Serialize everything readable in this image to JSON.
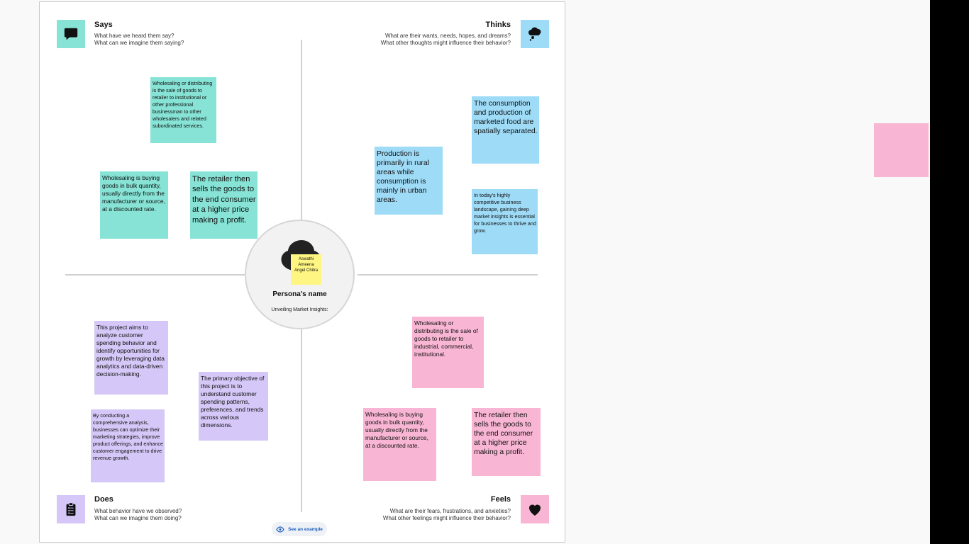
{
  "colors": {
    "teal": "#86e3d5",
    "blue": "#9edbf7",
    "purple": "#d5c7f7",
    "pink": "#f9b6d4",
    "yellow": "#fff583",
    "link": "#1d5fbf"
  },
  "quadrants": {
    "says": {
      "title": "Says",
      "line1": "What have we heard them say?",
      "line2": "What can we imagine them saying?",
      "icon": "speech-bubble-icon"
    },
    "thinks": {
      "title": "Thinks",
      "line1": "What are their wants, needs, hopes, and dreams?",
      "line2": "What other thoughts might influence their behavior?",
      "icon": "thought-cloud-icon"
    },
    "does": {
      "title": "Does",
      "line1": "What behavior have we observed?",
      "line2": "What can we imagine them doing?",
      "icon": "clipboard-icon"
    },
    "feels": {
      "title": "Feels",
      "line1": "What are their fears, frustrations, and anxieties?",
      "line2": "What other feelings might influence their behavior?",
      "icon": "heart-icon"
    }
  },
  "persona": {
    "name": "Persona's name",
    "subtitle": "Unveiling Market Insights:",
    "names_note": "Aswathi Ameena Angel Chitra",
    "avatar_icon": "persona-silhouette-icon"
  },
  "notes": {
    "says": [
      "Wholesaling or distributing is the sale of goods to retailer to institutional or other professional businessman to other wholesalers and related subordinated services.",
      " Wholesaling is buying goods in bulk quantity, usually directly from the manufacturer or source, at a discounted rate.",
      "The retailer then sells the goods to the end consumer at a higher price making a profit."
    ],
    "thinks": [
      "The consumption and production of marketed food are spatially separated.",
      "Production is primarily in rural areas while consumption is mainly in urban areas.",
      "In today's highly competitive business landscape, gaining deep market insights is essential for businesses to thrive and grow."
    ],
    "does": [
      "This project aims to analyze customer spending behavior and identify opportunities for growth by leveraging data analytics and data-driven decision-making.",
      "The primary objective of this project is to understand customer spending patterns, preferences, and trends across various dimensions.",
      " By conducting a comprehensive analysis, businesses can optimize their marketing strategies, improve product offerings, and enhance customer engagement to drive revenue growth."
    ],
    "feels": [
      "Wholesaling or distributing is the sale of goods to retailer to industrial, commercial, institutional.",
      " Wholesaling is buying goods in bulk quantity, usually directly from the manufacturer or source, at a discounted rate.",
      "The retailer then sells the goods to the end consumer at a higher price making a profit."
    ]
  },
  "footer": {
    "example_label": "See an example",
    "example_icon": "eye-icon"
  },
  "side_note": {
    "color": "pink",
    "text": ""
  }
}
